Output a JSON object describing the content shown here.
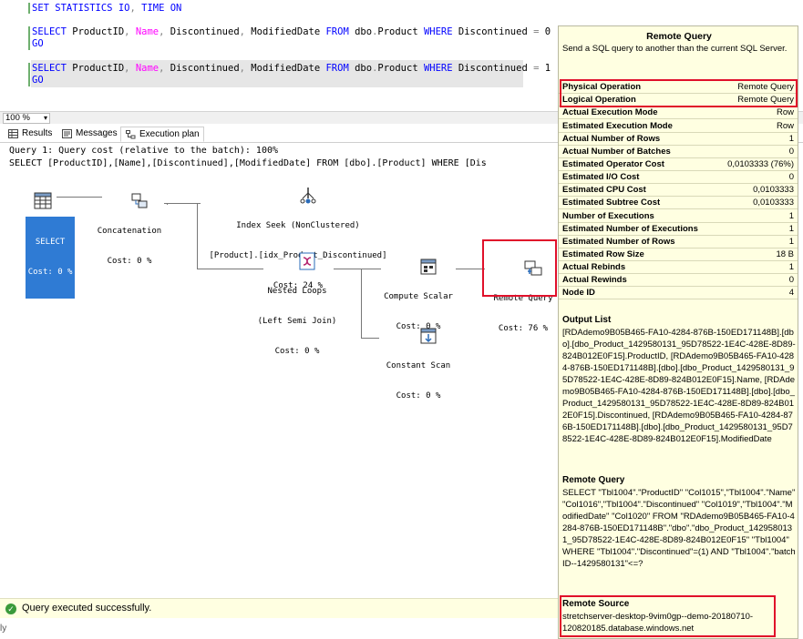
{
  "editor": {
    "lines": [
      {
        "parts": [
          {
            "t": "SET STATISTICS IO",
            "c": "kw"
          },
          {
            "t": ", ",
            "c": "gray"
          },
          {
            "t": "TIME ON",
            "c": "kw"
          }
        ]
      },
      {
        "parts": [
          {
            "t": "SELECT ",
            "c": "kw"
          },
          {
            "t": "ProductID",
            "c": "txt"
          },
          {
            "t": ", ",
            "c": "gray"
          },
          {
            "t": "Name",
            "c": "fn"
          },
          {
            "t": ", ",
            "c": "gray"
          },
          {
            "t": "Discontinued",
            "c": "txt"
          },
          {
            "t": ", ",
            "c": "gray"
          },
          {
            "t": "ModifiedDate ",
            "c": "txt"
          },
          {
            "t": "FROM ",
            "c": "kw"
          },
          {
            "t": "dbo",
            "c": "txt"
          },
          {
            "t": ".",
            "c": "gray"
          },
          {
            "t": "Product ",
            "c": "txt"
          },
          {
            "t": "WHERE ",
            "c": "kw"
          },
          {
            "t": "Discontinued ",
            "c": "txt"
          },
          {
            "t": "= ",
            "c": "gray"
          },
          {
            "t": "0",
            "c": "txt"
          }
        ]
      },
      {
        "parts": [
          {
            "t": "GO",
            "c": "kw"
          }
        ]
      },
      {
        "parts": [
          {
            "t": "SELECT ",
            "c": "kw"
          },
          {
            "t": "ProductID",
            "c": "txt"
          },
          {
            "t": ", ",
            "c": "gray"
          },
          {
            "t": "Name",
            "c": "fn"
          },
          {
            "t": ", ",
            "c": "gray"
          },
          {
            "t": "Discontinued",
            "c": "txt"
          },
          {
            "t": ", ",
            "c": "gray"
          },
          {
            "t": "ModifiedDate ",
            "c": "txt"
          },
          {
            "t": "FROM ",
            "c": "kw"
          },
          {
            "t": "dbo",
            "c": "txt"
          },
          {
            "t": ".",
            "c": "gray"
          },
          {
            "t": "Product ",
            "c": "txt"
          },
          {
            "t": "WHERE ",
            "c": "kw"
          },
          {
            "t": "Discontinued ",
            "c": "txt"
          },
          {
            "t": "= ",
            "c": "gray"
          },
          {
            "t": "1",
            "c": "txt"
          }
        ]
      },
      {
        "parts": [
          {
            "t": "GO",
            "c": "kw"
          }
        ]
      }
    ]
  },
  "zoom": {
    "value": "100 %"
  },
  "tabs": [
    {
      "label": "Results",
      "icon": "grid-icon"
    },
    {
      "label": "Messages",
      "icon": "messages-icon"
    },
    {
      "label": "Execution plan",
      "icon": "execution-plan-icon"
    }
  ],
  "plan": {
    "header_line1": "Query 1: Query cost (relative to the batch): 100%",
    "header_line2": "SELECT [ProductID],[Name],[Discontinued],[ModifiedDate] FROM [dbo].[Product] WHERE [Dis",
    "operators": {
      "select": {
        "label": "SELECT",
        "cost": "Cost: 0 %"
      },
      "concatenation": {
        "label": "Concatenation",
        "cost": "Cost: 0 %"
      },
      "index_seek": {
        "label": "Index Seek (NonClustered)",
        "object": "[Product].[idx_Product_Discontinued]",
        "cost": "Cost: 24 %"
      },
      "nested_loops": {
        "label": "Nested Loops",
        "sub": "(Left Semi Join)",
        "cost": "Cost: 0 %"
      },
      "compute_scalar": {
        "label": "Compute Scalar",
        "cost": "Cost: 0 %"
      },
      "remote_query": {
        "label": "Remote Query",
        "cost": "Cost: 76 %"
      },
      "constant_scan": {
        "label": "Constant Scan",
        "cost": "Cost: 0 %"
      }
    }
  },
  "status": {
    "message": "Query executed successfully."
  },
  "tooltip": {
    "title": "Remote Query",
    "description": "Send a SQL query to another than the current SQL Server.",
    "rows": [
      {
        "k": "Physical Operation",
        "v": "Remote Query"
      },
      {
        "k": "Logical Operation",
        "v": "Remote Query"
      },
      {
        "k": "Actual Execution Mode",
        "v": "Row"
      },
      {
        "k": "Estimated Execution Mode",
        "v": "Row"
      },
      {
        "k": "Actual Number of Rows",
        "v": "1"
      },
      {
        "k": "Actual Number of Batches",
        "v": "0"
      },
      {
        "k": "Estimated Operator Cost",
        "v": "0,0103333 (76%)"
      },
      {
        "k": "Estimated I/O Cost",
        "v": "0"
      },
      {
        "k": "Estimated CPU Cost",
        "v": "0,0103333"
      },
      {
        "k": "Estimated Subtree Cost",
        "v": "0,0103333"
      },
      {
        "k": "Number of Executions",
        "v": "1"
      },
      {
        "k": "Estimated Number of Executions",
        "v": "1"
      },
      {
        "k": "Estimated Number of Rows",
        "v": "1"
      },
      {
        "k": "Estimated Row Size",
        "v": "18 B"
      },
      {
        "k": "Actual Rebinds",
        "v": "1"
      },
      {
        "k": "Actual Rewinds",
        "v": "0"
      },
      {
        "k": "Node ID",
        "v": "4"
      }
    ],
    "output_list_title": "Output List",
    "output_list": "[RDAdemo9B05B465-FA10-4284-876B-150ED171148B].[dbo].[dbo_Product_1429580131_95D78522-1E4C-428E-8D89-824B012E0F15].ProductID, [RDAdemo9B05B465-FA10-4284-876B-150ED171148B].[dbo].[dbo_Product_1429580131_95D78522-1E4C-428E-8D89-824B012E0F15].Name, [RDAdemo9B05B465-FA10-4284-876B-150ED171148B].[dbo].[dbo_Product_1429580131_95D78522-1E4C-428E-8D89-824B012E0F15].Discontinued, [RDAdemo9B05B465-FA10-4284-876B-150ED171148B].[dbo].[dbo_Product_1429580131_95D78522-1E4C-428E-8D89-824B012E0F15].ModifiedDate",
    "remote_query_title": "Remote Query",
    "remote_query": "SELECT \"Tbl1004\".\"ProductID\" \"Col1015\",\"Tbl1004\".\"Name\" \"Col1016\",\"Tbl1004\".\"Discontinued\" \"Col1019\",\"Tbl1004\".\"ModifiedDate\" \"Col1020\" FROM \"RDAdemo9B05B465-FA10-4284-876B-150ED171148B\".\"dbo\".\"dbo_Product_1429580131_95D78522-1E4C-428E-8D89-824B012E0F15\" \"Tbl1004\" WHERE \"Tbl1004\".\"Discontinued\"=(1) AND \"Tbl1004\".\"batchID--1429580131\"<=?",
    "remote_source_title": "Remote Source",
    "remote_source": "stretchserver-desktop-9vim0gp--demo-20180710-120820185.database.windows.net"
  }
}
